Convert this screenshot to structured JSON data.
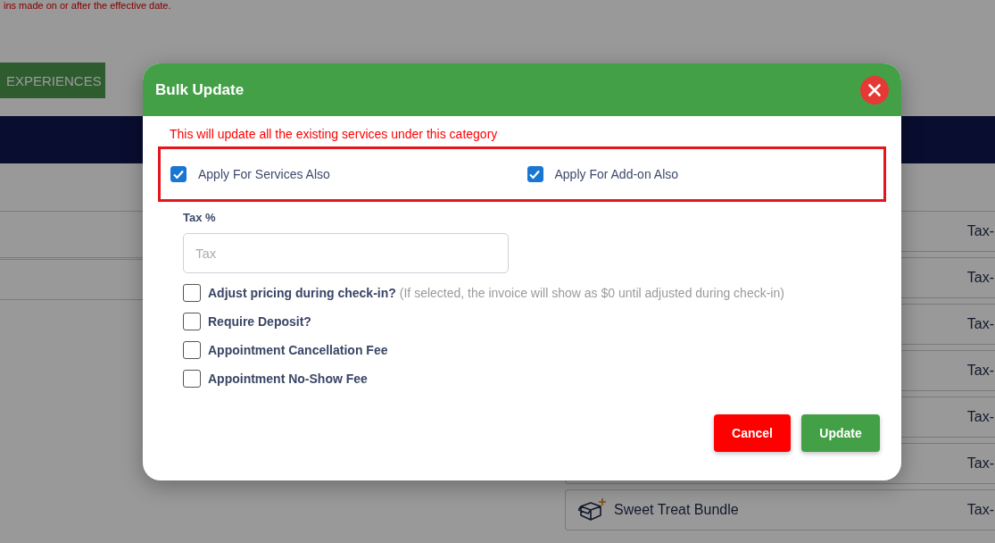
{
  "background_page": {
    "notice": "ins made on or after the effective date.",
    "experiences_button": "EXPERIENCES",
    "list_cards": [
      {
        "tax": "Tax-"
      },
      {
        "tax": "Tax-"
      },
      {
        "tax": "Tax-"
      },
      {
        "tax": "Tax-"
      },
      {
        "tax": "Tax-"
      },
      {
        "tax": "Tax-"
      },
      {
        "name": "Sweet Treat Bundle",
        "tax": "Tax-"
      }
    ]
  },
  "dialog": {
    "title": "Bulk Update",
    "warning": "This will update all the existing services under this category",
    "apply_options": [
      {
        "label": "Apply For Services Also",
        "checked": true
      },
      {
        "label": "Apply For Add-on Also",
        "checked": true
      }
    ],
    "tax_field": {
      "label": "Tax %",
      "placeholder": "Tax"
    },
    "options": [
      {
        "label": "Adjust pricing during check-in?",
        "note": "(If selected, the invoice will show as $0 until adjusted during check-in)",
        "checked": false
      },
      {
        "label": "Require Deposit?",
        "checked": false
      },
      {
        "label": "Appointment Cancellation Fee",
        "checked": false
      },
      {
        "label": "Appointment No-Show Fee",
        "checked": false
      }
    ],
    "buttons": [
      {
        "label": "Cancel",
        "kind": "cancel"
      },
      {
        "label": "Update",
        "kind": "primary"
      }
    ]
  }
}
